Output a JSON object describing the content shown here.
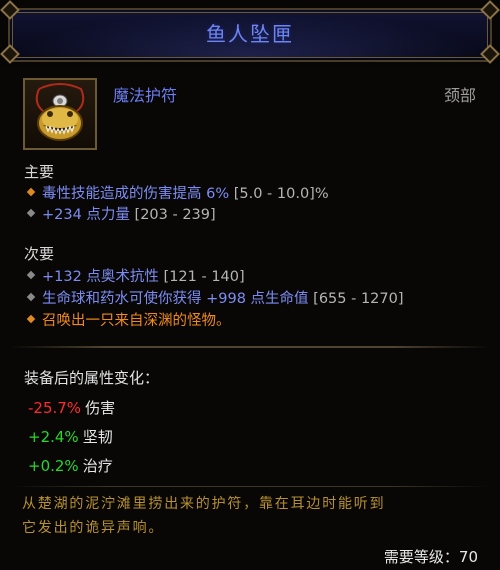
{
  "item": {
    "name": "鱼人坠匣",
    "type": "魔法护符",
    "slot": "颈部"
  },
  "primary": {
    "label": "主要",
    "affixes": [
      {
        "bullet": "orange",
        "text": "毒性技能造成的伤害提高 6%",
        "range": "[5.0 - 10.0]%"
      },
      {
        "bullet": "gray",
        "text": "+234 点力量",
        "range": "[203 - 239]"
      }
    ]
  },
  "secondary": {
    "label": "次要",
    "affixes": [
      {
        "bullet": "gray",
        "text": "+132 点奥术抗性",
        "range": "[121 - 140]"
      },
      {
        "bullet": "gray",
        "text": "生命球和药水可使你获得 +998 点生命值",
        "range": "[655 - 1270]"
      },
      {
        "bullet": "orange",
        "text": "召唤出一只来自深渊的怪物。",
        "range": ""
      }
    ]
  },
  "stat_changes": {
    "title": "装备后的属性变化：",
    "rows": [
      {
        "value": "-25.7%",
        "name": "伤害",
        "sign": "negative"
      },
      {
        "value": "+2.4%",
        "name": "坚韧",
        "sign": "positive"
      },
      {
        "value": "+0.2%",
        "name": "治疗",
        "sign": "positive"
      }
    ]
  },
  "flavor_text": {
    "line1": "从楚湖的泥泞滩里捞出来的护符，靠在耳边时能听到",
    "line2": "它发出的诡异声响。"
  },
  "requirement": {
    "label": "需要等级：70"
  },
  "colors": {
    "magic_blue": "#7d8cf2",
    "legendary_orange": "#f08a1c",
    "negative_red": "#ff2a2a",
    "positive_green": "#27d827",
    "flavor_gold": "#b8912f"
  },
  "icons": {
    "item_icon": "fishman-amulet-icon"
  }
}
